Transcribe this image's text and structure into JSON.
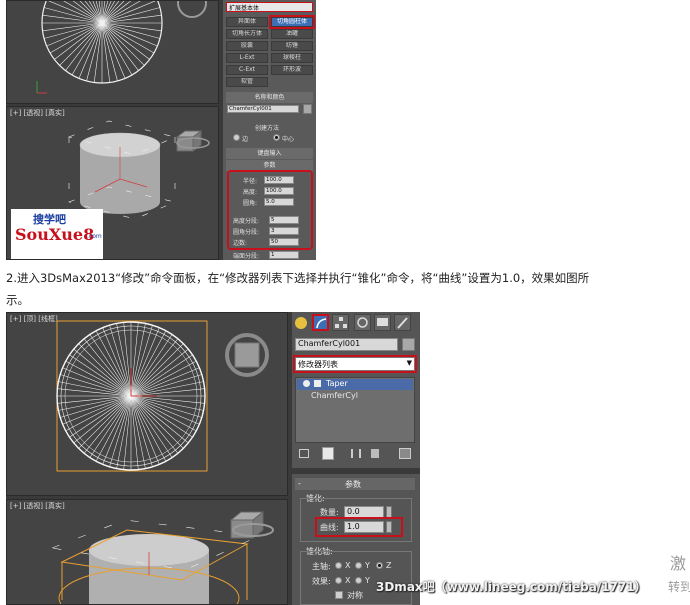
{
  "screenshot1": {
    "viewport_label": "[+] [透视] [真实]",
    "panel": {
      "dropdown": "扩展基本体",
      "object_buttons": [
        "异面体",
        "切角长方体",
        "油罐",
        "胶囊",
        "纺锤",
        "L-Ext",
        "球棱柱",
        "C-Ext",
        "环形波",
        "软管",
        "棱柱"
      ],
      "selected_button": "切角圆柱体",
      "name_color_rollout": "名称和颜色",
      "object_name": "ChamferCyl001",
      "smooth_options_title": "创建方法",
      "radio_edge": "边",
      "radio_center": "中心",
      "keyboard_rollout": "键盘输入",
      "params_rollout": "参数",
      "params": [
        {
          "label": "半径:",
          "value": "100.0"
        },
        {
          "label": "高度:",
          "value": "100.0"
        },
        {
          "label": "圆角:",
          "value": "5.0"
        },
        {
          "label": "高度分段:",
          "value": "5"
        },
        {
          "label": "圆角分段:",
          "value": "3"
        },
        {
          "label": "边数:",
          "value": "50"
        },
        {
          "label": "端面分段:",
          "value": "1"
        }
      ]
    },
    "watermark": {
      "top": "搜学吧",
      "logo": "SouXue8",
      "domain": ".com"
    }
  },
  "caption": {
    "line1": "2.进入3DsMax2013“修改”命令面板，在“修改器列表下选择并执行“锥化”命令，将“曲线”设置为1.0，效果如图所",
    "line2": "示。"
  },
  "screenshot2": {
    "viewport_top_label": "[+] [顶] [线框]",
    "viewport_bottom_label": "[+] [透视] [真实]",
    "panel": {
      "object_name": "ChamferCyl001",
      "modifier_list": "修改器列表",
      "stack_items": [
        "Taper",
        "ChamferCyl"
      ],
      "params_rollout": "参数",
      "taper_group": "锥化:",
      "amount_label": "数量:",
      "amount_value": "0.0",
      "curve_label": "曲线:",
      "curve_value": "1.0",
      "taper_axis_group": "锥化轴:",
      "primary_label": "主轴:",
      "effect_label": "效果:",
      "axis_x": "X",
      "axis_y": "Y",
      "axis_z": "Z",
      "symmetry_label": "对称"
    }
  },
  "side_text": {
    "activate": "激",
    "goto": "转到"
  },
  "bottom_watermark": "3Dmax吧（www.lineeg.com/tieba/1771）",
  "colors": {
    "viewport_bg": "#444444",
    "panel_bg": "#5a5a5a",
    "highlight_red": "#c8101a",
    "active_blue": "#3d6fb5",
    "selection_orange": "#e8a030"
  }
}
